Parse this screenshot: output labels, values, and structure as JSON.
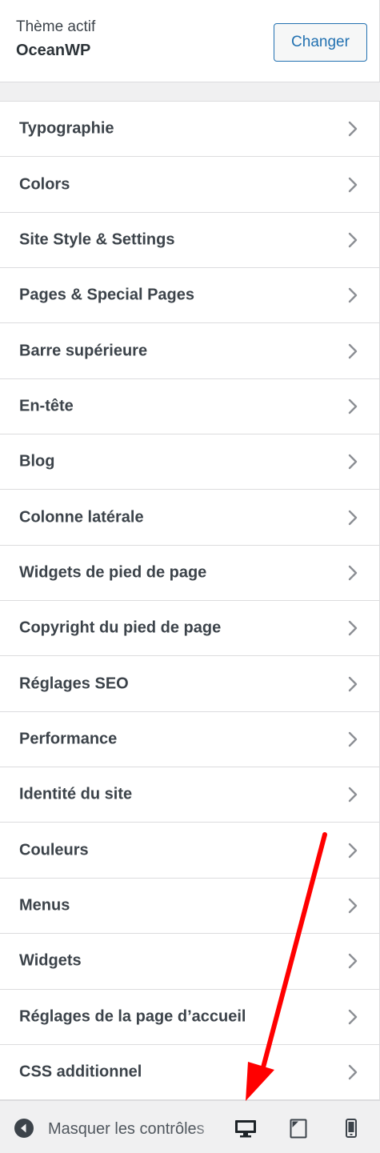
{
  "theme": {
    "label": "Thème actif",
    "name": "OceanWP",
    "change_button": "Changer"
  },
  "menu_items": [
    {
      "label": "Typographie"
    },
    {
      "label": "Colors"
    },
    {
      "label": "Site Style & Settings"
    },
    {
      "label": "Pages & Special Pages"
    },
    {
      "label": "Barre supérieure"
    },
    {
      "label": "En-tête"
    },
    {
      "label": "Blog"
    },
    {
      "label": "Colonne latérale"
    },
    {
      "label": "Widgets de pied de page"
    },
    {
      "label": "Copyright du pied de page"
    },
    {
      "label": "Réglages SEO"
    },
    {
      "label": "Performance"
    },
    {
      "label": "Identité du site"
    },
    {
      "label": "Couleurs"
    },
    {
      "label": "Menus"
    },
    {
      "label": "Widgets"
    },
    {
      "label": "Réglages de la page d’accueil"
    },
    {
      "label": "CSS additionnel"
    }
  ],
  "footer": {
    "collapse_label": "Masquer les contrôles",
    "devices": [
      "desktop",
      "tablet",
      "mobile"
    ],
    "active_device": "desktop"
  },
  "icons": {
    "menu_chevron": "chevron-right-icon",
    "collapse": "arrow-left-circle-icon",
    "desktop": "desktop-icon",
    "tablet": "tablet-icon",
    "mobile": "mobile-icon"
  },
  "annotation": {
    "color": "#ff0000",
    "shape": "arrow",
    "points_to": "desktop-preview-button"
  },
  "colors": {
    "accent": "#2271b1",
    "text": "#3c434a",
    "background": "#f0f0f1"
  }
}
